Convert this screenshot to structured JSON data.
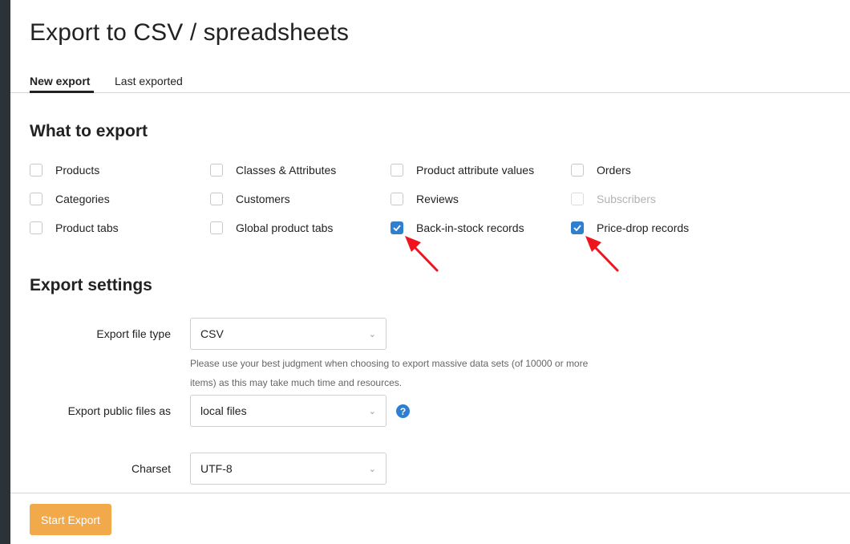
{
  "title": "Export to CSV / spreadsheets",
  "tabs": [
    {
      "label": "New export",
      "active": true
    },
    {
      "label": "Last exported",
      "active": false
    }
  ],
  "what": {
    "title": "What to export",
    "options": [
      {
        "label": "Products",
        "checked": false,
        "disabled": false
      },
      {
        "label": "Classes & Attributes",
        "checked": false,
        "disabled": false
      },
      {
        "label": "Product attribute values",
        "checked": false,
        "disabled": false
      },
      {
        "label": "Orders",
        "checked": false,
        "disabled": false
      },
      {
        "label": "Categories",
        "checked": false,
        "disabled": false
      },
      {
        "label": "Customers",
        "checked": false,
        "disabled": false
      },
      {
        "label": "Reviews",
        "checked": false,
        "disabled": false
      },
      {
        "label": "Subscribers",
        "checked": false,
        "disabled": true
      },
      {
        "label": "Product tabs",
        "checked": false,
        "disabled": false
      },
      {
        "label": "Global product tabs",
        "checked": false,
        "disabled": false
      },
      {
        "label": "Back-in-stock records",
        "checked": true,
        "disabled": false
      },
      {
        "label": "Price-drop records",
        "checked": true,
        "disabled": false
      }
    ]
  },
  "settings": {
    "title": "Export settings",
    "file_type": {
      "label": "Export file type",
      "value": "CSV"
    },
    "help": "Please use your best judgment when choosing to export massive data sets (of 10000 or more items) as this may take much time and resources.",
    "public_files": {
      "label": "Export public files as",
      "value": "local files",
      "help_icon": "?"
    },
    "charset": {
      "label": "Charset",
      "value": "UTF-8"
    }
  },
  "footer": {
    "start_label": "Start Export"
  },
  "colors": {
    "accent": "#2e7fd0",
    "button": "#f2a94a",
    "arrow": "#f0141e",
    "rail": "#2b3238"
  }
}
